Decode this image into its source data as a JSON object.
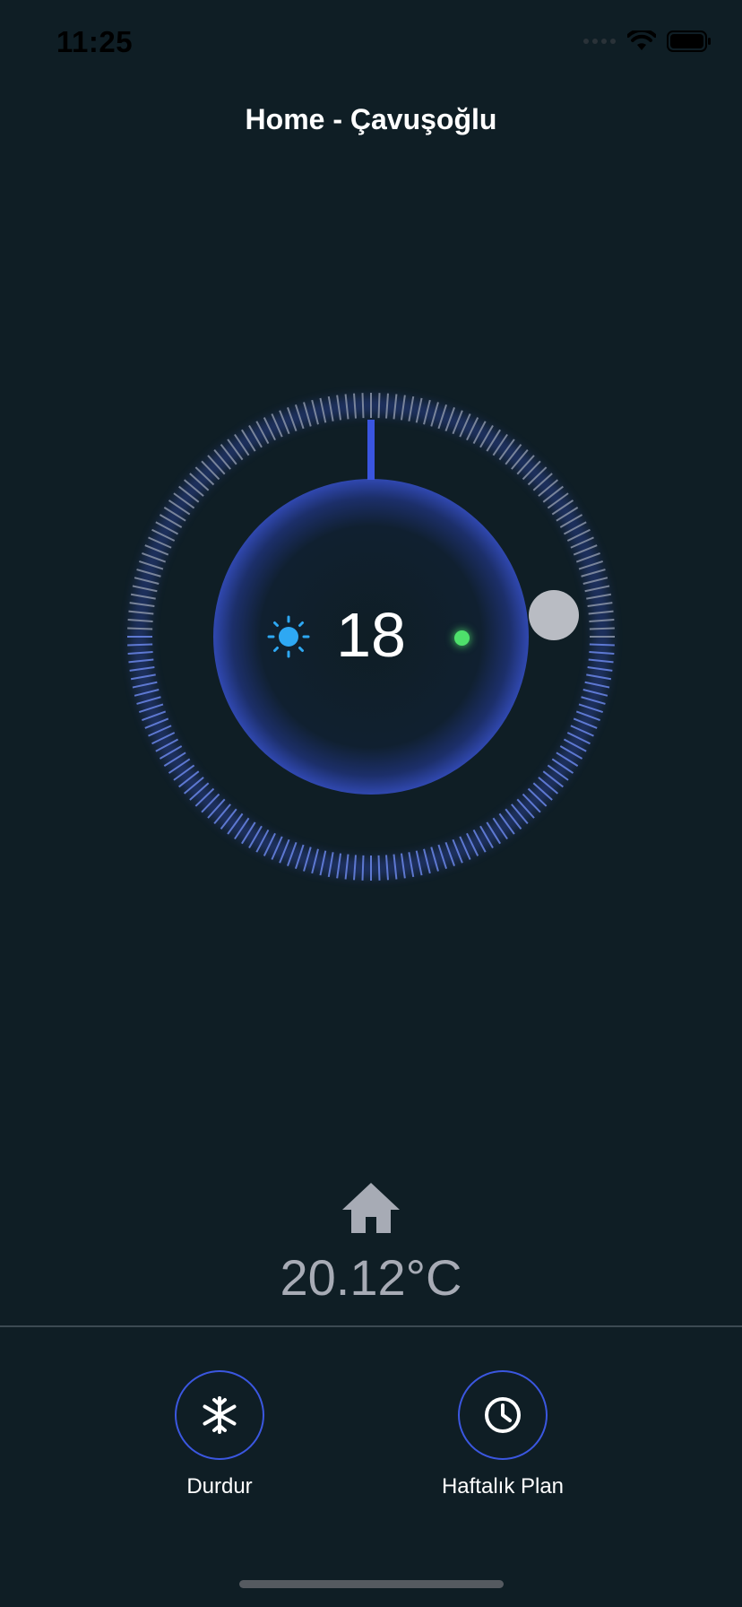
{
  "status_bar": {
    "time": "11:25",
    "icons": [
      "signal-dots-icon",
      "wifi-icon",
      "battery-icon"
    ]
  },
  "header": {
    "title": "Home - Çavuşoğlu"
  },
  "thermostat": {
    "setpoint": "18",
    "mode_icon": "sun-icon",
    "status_indicator": "active",
    "accent_color": "#3b57e0",
    "status_color": "#4ee06b"
  },
  "current": {
    "icon": "home-icon",
    "temperature": "20.12°C"
  },
  "actions": [
    {
      "label": "Durdur",
      "icon": "snowflake-icon"
    },
    {
      "label": "Haftalık Plan",
      "icon": "clock-icon"
    }
  ],
  "colors": {
    "background": "#0f1e25",
    "muted_text": "#a7abb5"
  }
}
